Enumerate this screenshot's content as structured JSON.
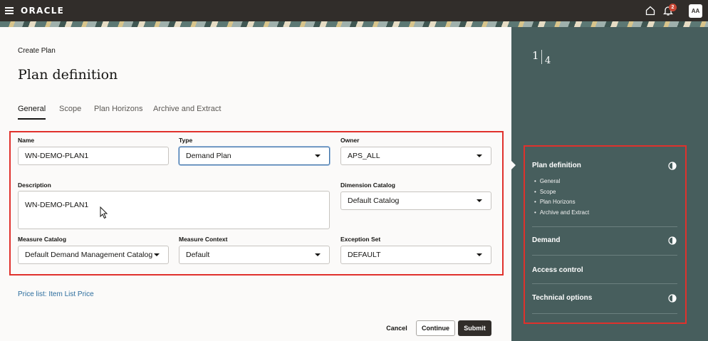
{
  "header": {
    "brand": "ORACLE",
    "notification_count": "2",
    "avatar_initials": "AA"
  },
  "page": {
    "breadcrumb": "Create Plan",
    "title": "Plan definition",
    "tabs": [
      "General",
      "Scope",
      "Plan Horizons",
      "Archive and Extract"
    ],
    "active_tab": "General"
  },
  "form": {
    "name": {
      "label": "Name",
      "value": "WN-DEMO-PLAN1"
    },
    "type": {
      "label": "Type",
      "value": "Demand Plan"
    },
    "owner": {
      "label": "Owner",
      "value": "APS_ALL"
    },
    "description": {
      "label": "Description",
      "value": "WN-DEMO-PLAN1"
    },
    "dimension_catalog": {
      "label": "Dimension Catalog",
      "value": "Default Catalog"
    },
    "measure_catalog": {
      "label": "Measure Catalog",
      "value": "Default Demand Management Catalog"
    },
    "measure_context": {
      "label": "Measure Context",
      "value": "Default"
    },
    "exception_set": {
      "label": "Exception Set",
      "value": "DEFAULT"
    }
  },
  "price_list_link": "Price list: Item List Price",
  "actions": {
    "cancel": "Cancel",
    "continue": "Continue",
    "submit": "Submit"
  },
  "sidebar": {
    "step_current": "1",
    "step_total": "4",
    "sections": [
      {
        "title": "Plan definition",
        "items": [
          "General",
          "Scope",
          "Plan Horizons",
          "Archive and Extract"
        ]
      },
      {
        "title": "Demand"
      },
      {
        "title": "Access control"
      },
      {
        "title": "Technical options"
      }
    ]
  },
  "colors": {
    "topbar": "#312d2a",
    "side_panel": "#475e5d",
    "highlight": "#e0312c",
    "link": "#2c6d9e",
    "badge": "#c74634"
  },
  "icons": [
    "menu-icon",
    "home-icon",
    "bell-icon",
    "chevron-down-icon",
    "half-circle-icon",
    "mouse-pointer-icon"
  ]
}
